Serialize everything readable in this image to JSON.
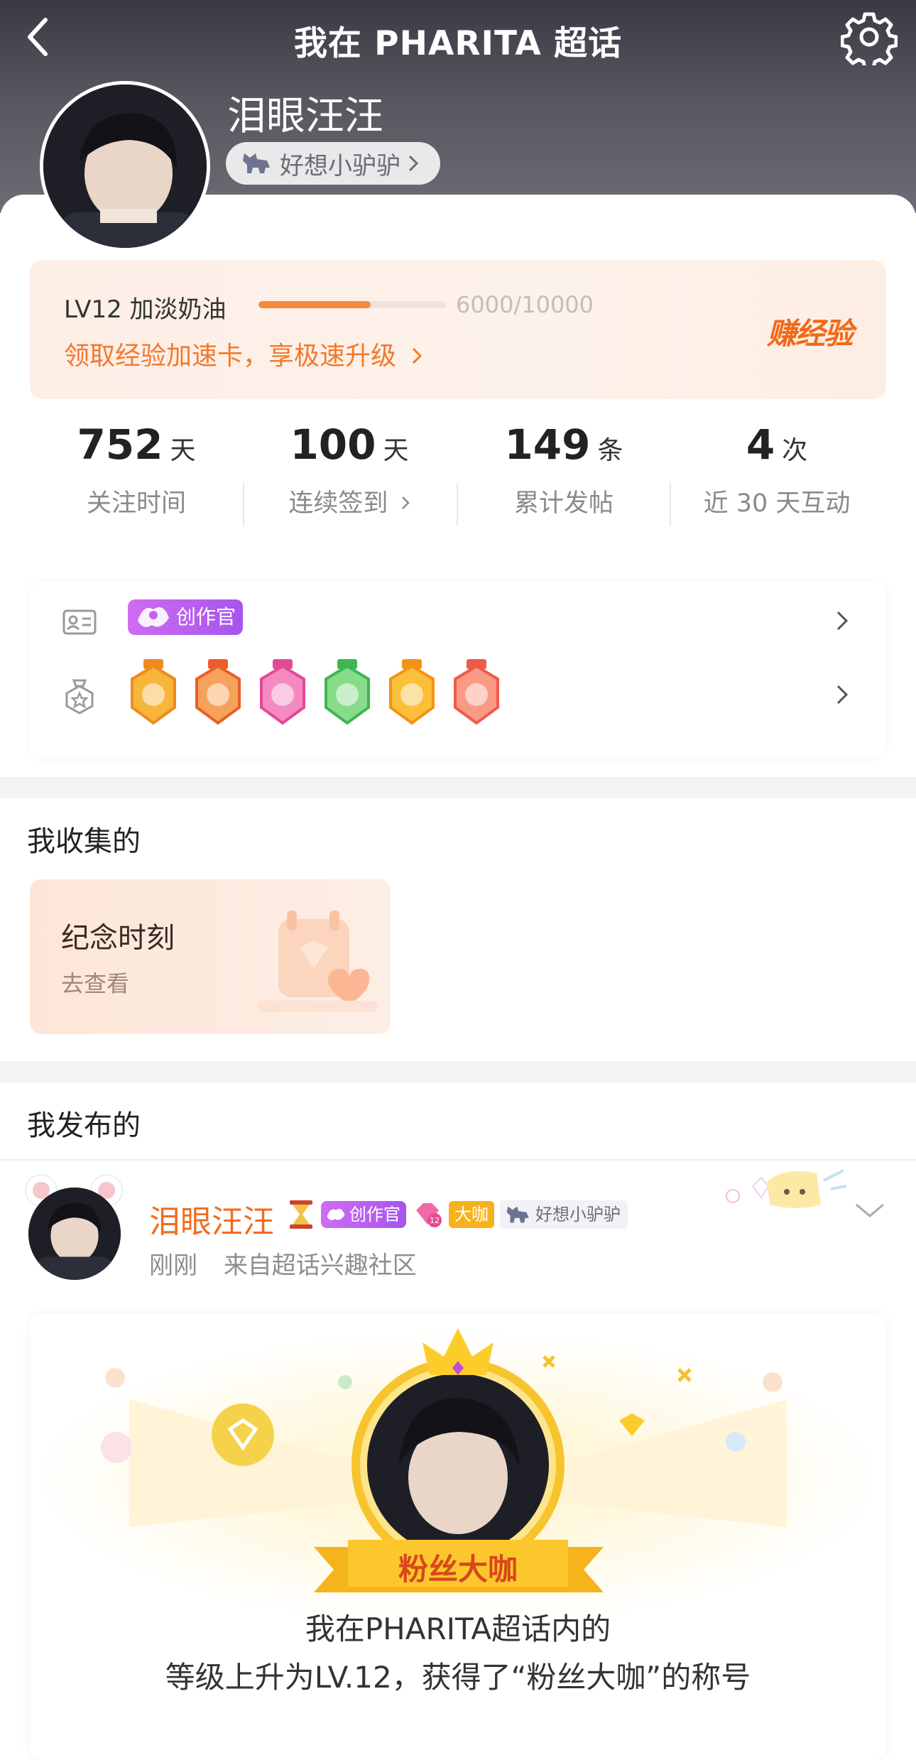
{
  "header": {
    "title": "我在 PHARITA 超话",
    "back_icon": "chevron-left-icon",
    "settings_icon": "gear-icon"
  },
  "profile": {
    "username": "泪眼汪汪",
    "tag": "好想小驴驴",
    "tag_icon": "donkey-icon"
  },
  "level": {
    "title": "LV12 加淡奶油",
    "progress_text": "6000/10000",
    "progress_fraction": 0.6,
    "tip": "领取经验加速卡，享极速升级",
    "earn_label": "赚经验",
    "accent": "#f2792c"
  },
  "stats": [
    {
      "value": "752",
      "unit": "天",
      "label": "关注时间"
    },
    {
      "value": "100",
      "unit": "天",
      "label": "连续签到"
    },
    {
      "value": "149",
      "unit": "条",
      "label": "累计发帖"
    },
    {
      "value": "4",
      "unit": "次",
      "label": "近 30 天互动"
    }
  ],
  "identity": {
    "role_tag": "创作官",
    "medals": [
      "crown-medal",
      "100-days-medal",
      "lv12-medal",
      "hands-medal",
      "30-days-medal",
      "rock-hand-medal"
    ]
  },
  "collected": {
    "title": "我收集的",
    "card_title": "纪念时刻",
    "card_sub": "去查看"
  },
  "published": {
    "title": "我发布的",
    "post": {
      "author": "泪眼汪汪",
      "role_tag": "创作官",
      "big_tag": "大咖",
      "fan_tag": "好想小驴驴",
      "time": "刚刚",
      "source": "来自超话兴趣社区",
      "ribbon": "粉丝大咖",
      "line1": "我在PHARITA超话内的",
      "line2": "等级上升为LV.12，获得了“粉丝大咖”的称号"
    }
  }
}
